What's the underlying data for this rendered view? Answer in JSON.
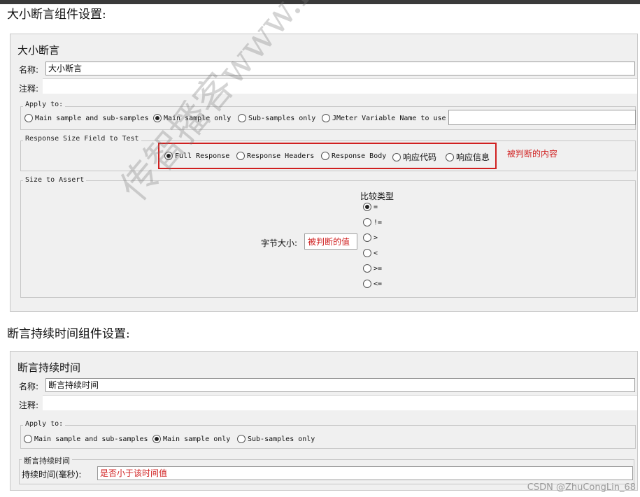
{
  "section1": {
    "heading": "大小断言组件设置:",
    "panel_title": "大小断言",
    "name_label": "名称:",
    "name_value": "大小断言",
    "comment_label": "注释:",
    "apply_to": {
      "legend": "Apply to:",
      "options": [
        "Main sample and sub-samples",
        "Main sample only",
        "Sub-samples only",
        "JMeter Variable Name to use"
      ],
      "selected": "Main sample only"
    },
    "response_field": {
      "legend": "Response Size Field to Test",
      "options": [
        "Full Response",
        "Response Headers",
        "Response Body",
        "响应代码",
        "响应信息"
      ],
      "selected": "Full Response",
      "annotation": "被判断的内容"
    },
    "size_to_assert": {
      "legend": "Size to Assert",
      "size_label": "字节大小:",
      "size_value": "被判断的值",
      "compare_title": "比较类型",
      "compare_options": [
        "=",
        "!=",
        ">",
        "<",
        ">=",
        "<="
      ],
      "selected": "="
    }
  },
  "section2": {
    "heading": "断言持续时间组件设置:",
    "panel_title": "断言持续时间",
    "name_label": "名称:",
    "name_value": "断言持续时间",
    "comment_label": "注释:",
    "apply_to": {
      "legend": "Apply to:",
      "options": [
        "Main sample and sub-samples",
        "Main sample only",
        "Sub-samples only"
      ],
      "selected": "Main sample only"
    },
    "duration": {
      "legend": "断言持续时间",
      "label": "持续时间(毫秒):",
      "value": "是否小于该时间值"
    }
  },
  "watermark": "传智播客www.itcast.",
  "credit": "CSDN @ZhuCongLin_68",
  "colors": {
    "annotation": "#d02020",
    "panel": "#f0f0f0"
  }
}
